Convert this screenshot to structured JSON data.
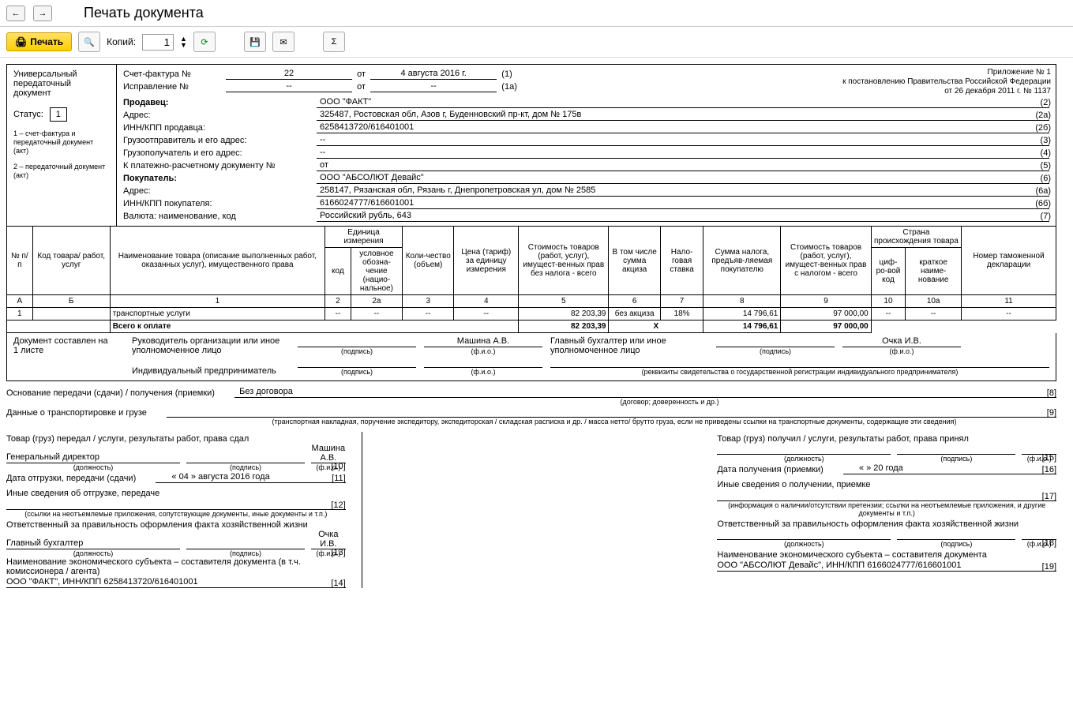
{
  "window": {
    "title": "Печать документа"
  },
  "toolbar": {
    "print": "Печать",
    "copies_label": "Копий:",
    "copies_value": "1"
  },
  "side": {
    "upd1": "Универсальный",
    "upd2": "передаточный",
    "upd3": "документ",
    "status_label": "Статус:",
    "status_value": "1",
    "note1": "1 – счет-фактура и передаточный документ (акт)",
    "note2": "2 – передаточный документ (акт)"
  },
  "head": {
    "appendix1": "Приложение № 1",
    "appendix2": "к постановлению Правительства Российской Федерации",
    "appendix3": "от 26 декабря 2011 г. № 1137",
    "sfLabel": "Счет-фактура №",
    "sfNo": "22",
    "ot": "от",
    "sfDate": "4 августа 2016 г.",
    "isprLabel": "Исправление №",
    "isprNo": "--",
    "isprDate": "--",
    "sellerLabel": "Продавец:",
    "seller": "ООО \"ФАКТ\"",
    "addrLabel": "Адрес:",
    "sellerAddr": "325487, Ростовская обл, Азов г, Буденновский пр-кт, дом № 175в",
    "innLabel": "ИНН/КПП продавца:",
    "sellerInn": "6258413720/616401001",
    "shipperLabel": "Грузоотправитель и его адрес:",
    "shipper": "--",
    "consigneeLabel": "Грузополучатель и его адрес:",
    "consignee": "--",
    "payDocLabel": "К платежно-расчетному документу №",
    "payDoc": "от",
    "buyerLabel": "Покупатель:",
    "buyer": "ООО \"АБСОЛЮТ Девайс\"",
    "buyerAddr": "258147, Рязанская обл, Рязань г, Днепропетровская ул, дом № 2585",
    "buyerInnLabel": "ИНН/КПП покупателя:",
    "buyerInn": "6166024777/616601001",
    "currLabel": "Валюта: наименование, код",
    "curr": "Российский рубль, 643",
    "codes": {
      "c1": "(1)",
      "c1a": "(1а)",
      "c2": "(2)",
      "c2a": "(2а)",
      "c26": "(2б)",
      "c3": "(3)",
      "c4": "(4)",
      "c5": "(5)",
      "c6": "(6)",
      "c6a": "(6а)",
      "c66": "(6б)",
      "c7": "(7)"
    }
  },
  "cols": {
    "h1": "№ п/п",
    "h2": "Код товара/ работ, услуг",
    "h3": "Наименование товара (описание выполненных работ, оказанных услуг), имущественного права",
    "h4": "Единица измерения",
    "h4a": "код",
    "h4b": "условное обозна-чение (нацио-нальное)",
    "h5": "Коли-чество (объем)",
    "h6": "Цена (тариф) за единицу измерения",
    "h7": "Стоимость товаров (работ, услуг), имущест-венных прав без налога - всего",
    "h8": "В том числе сумма акциза",
    "h9": "Нало-говая ставка",
    "h10": "Сумма налога, предъяв-ляемая покупателю",
    "h11": "Стоимость товаров (работ, услуг), имущест-венных прав с налогом - всего",
    "h12": "Страна происхождения товара",
    "h12a": "циф-ро-вой код",
    "h12b": "краткое наиме-нование",
    "h13": "Номер таможенной декларации",
    "nA": "А",
    "nB": "Б",
    "n1": "1",
    "n2": "2",
    "n2a": "2а",
    "n3": "3",
    "n4": "4",
    "n5": "5",
    "n6": "6",
    "n7": "7",
    "n8": "8",
    "n9": "9",
    "n10": "10",
    "n10a": "10а",
    "n11": "11"
  },
  "items": [
    {
      "n": "1",
      "code": "",
      "name": "транспортные услуги",
      "u1": "--",
      "u2": "--",
      "qty": "--",
      "price": "--",
      "sum": "82 203,39",
      "excise": "без акциза",
      "rate": "18%",
      "tax": "14 796,61",
      "total": "97 000,00",
      "c10": "--",
      "c10a": "--",
      "c11": "--"
    }
  ],
  "totals": {
    "label": "Всего к оплате",
    "sum": "82 203,39",
    "x": "Х",
    "tax": "14 796,61",
    "total": "97 000,00"
  },
  "sign": {
    "docOn": "Документ составлен на",
    "sheets": "1 листе",
    "rukLabel": "Руководитель организации или иное уполномоченное лицо",
    "ruk": "Машина А.В.",
    "glavLabel": "Главный бухгалтер или иное уполномоченное лицо",
    "glav": "Очка И.В.",
    "ipLabel": "Индивидуальный предприниматель",
    "cap1": "(подпись)",
    "cap2": "(ф.и.о.)",
    "cap3": "(реквизиты свидетельства о государственной  регистрации индивидуального предпринимателя)"
  },
  "transfer": {
    "osnLabel": "Основание передачи (сдачи) / получения (приемки)",
    "osn": "Без договора",
    "osnCap": "(договор; доверенность и др.)",
    "n8": "[8]",
    "transLabel": "Данные о транспортировке и грузе",
    "transCap": "(транспортная накладная, поручение экспедитору, экспедиторская / складская расписка и др. / масса нетто/ брутто груза, если не приведены ссылки на транспортные документы, содержащие эти сведения)",
    "n9": "[9]",
    "leftTitle": "Товар (груз) передал / услуги, результаты работ, права сдал",
    "leftPos": "Генеральный директор",
    "leftFio": "Машина А.В.",
    "n10": "[10]",
    "capPos": "(должность)",
    "capSig": "(подпись)",
    "capFio": "(ф.и.о.)",
    "dateShipLabel": "Дата отгрузки, передачи (сдачи)",
    "dateShip": "« 04 »   августа   2016   года",
    "n11": "[11]",
    "otherShipLabel": "Иные сведения об отгрузке, передаче",
    "n12": "[12]",
    "otherShipCap": "(ссылки на неотъемлемые приложения, сопутствующие документы, иные документы и т.п.)",
    "respLabel": "Ответственный за правильность оформления факта хозяйственной жизни",
    "respPos": "Главный бухгалтер",
    "respFio": "Очка И.В.",
    "n13": "[13]",
    "entityLabel": "Наименование экономического субъекта – составителя документа (в т.ч. комиссионера / агента)",
    "entity": "ООО \"ФАКТ\", ИНН/КПП 6258413720/616401001",
    "n14": "[14]",
    "rightTitle": "Товар (груз) получил / услуги, результаты работ, права принял",
    "n15": "[15]",
    "dateRecvLabel": "Дата получения (приемки)",
    "dateRecv": "«       »                        20       года",
    "n16": "[16]",
    "otherRecvLabel": "Иные сведения о получении, приемке",
    "n17": "[17]",
    "otherRecvCap": "(информация о наличии/отсутствии претензии; ссылки на неотъемлемые приложения, и другие  документы и т.п.)",
    "n18": "[18]",
    "entityRLabel": "Наименование экономического субъекта – составителя документа",
    "entityR": "ООО \"АБСОЛЮТ Девайс\", ИНН/КПП 6166024777/616601001",
    "n19": "[19]"
  }
}
